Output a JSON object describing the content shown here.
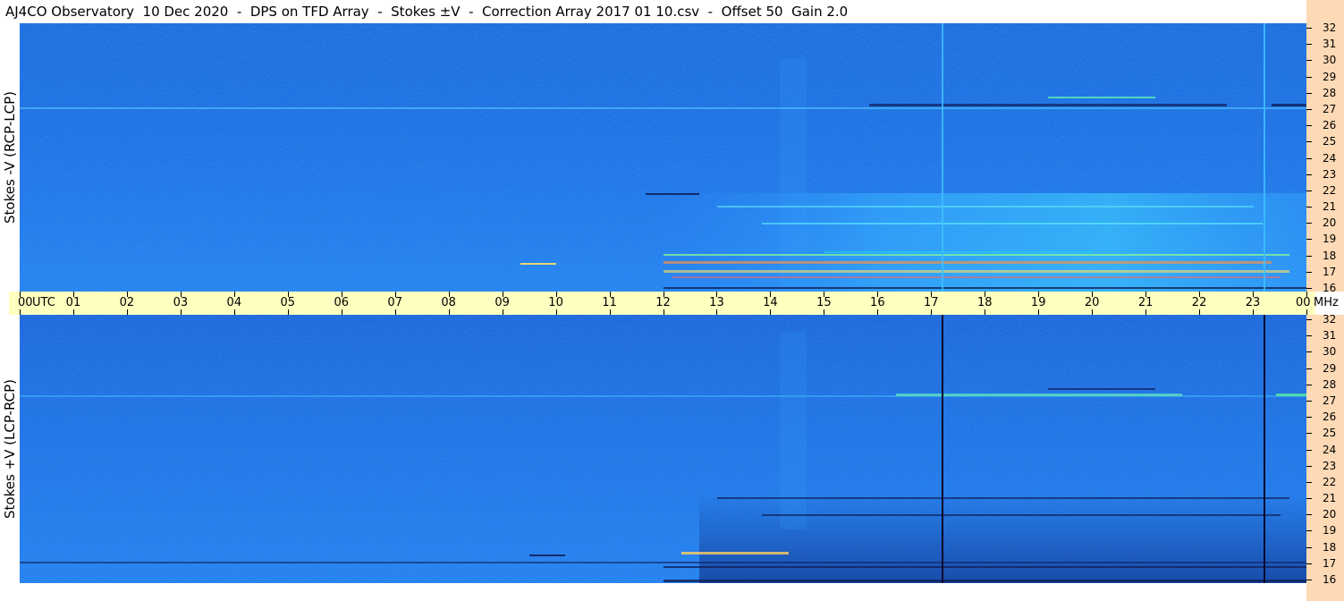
{
  "window": {
    "title": "AJ4CO Observatory  10 Dec 2020  -  DPS on TFD Array  -  Stokes ±V  -  Correction Array 2017 01 10.csv  -  Offset 50  Gain 2.0"
  },
  "panels": [
    {
      "label": "Stokes -V (RCP-LCP)"
    },
    {
      "label": "Stokes +V (LCP-RCP)"
    }
  ],
  "time_axis": {
    "unit": "UTC",
    "ticks": [
      "00",
      "01",
      "02",
      "03",
      "04",
      "05",
      "06",
      "07",
      "08",
      "09",
      "10",
      "11",
      "12",
      "13",
      "14",
      "15",
      "16",
      "17",
      "18",
      "19",
      "20",
      "21",
      "22",
      "23",
      "00"
    ]
  },
  "freq_axis": {
    "unit": "MHz",
    "ticks": [
      "32",
      "31",
      "30",
      "29",
      "28",
      "27",
      "26",
      "25",
      "24",
      "23",
      "22",
      "21",
      "20",
      "19",
      "18",
      "17",
      "16"
    ]
  },
  "colors": {
    "background_blue": "#1f6fe0",
    "axis_strip": "#ffffc0",
    "freq_column": "#fdd9b5"
  }
}
